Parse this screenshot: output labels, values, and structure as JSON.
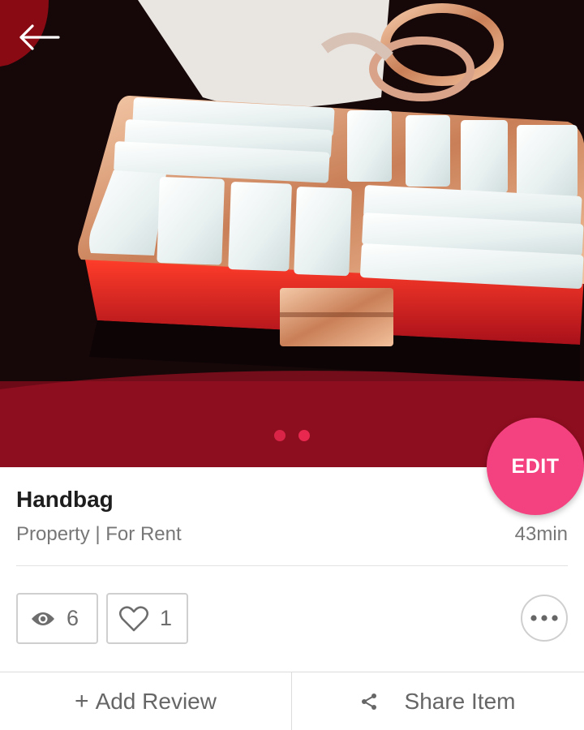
{
  "listing": {
    "title": "Handbag",
    "category": "Property | For Rent",
    "posted_ago": "43min"
  },
  "stats": {
    "views": "6",
    "likes": "1"
  },
  "actions": {
    "edit_label": "EDIT",
    "add_review_label": "Add Review",
    "add_review_icon": "+",
    "share_label": "Share Item"
  },
  "carousel": {
    "page_count": 2,
    "active_index": 0
  },
  "icons": {
    "back": "arrow-left-icon",
    "views": "eye-icon",
    "likes": "heart-outline-icon",
    "more": "more-horizontal-icon",
    "share": "share-icon"
  },
  "colors": {
    "accent": "#f4417f",
    "dot_active": "#e8284f",
    "dot_inactive": "#e8284f"
  }
}
